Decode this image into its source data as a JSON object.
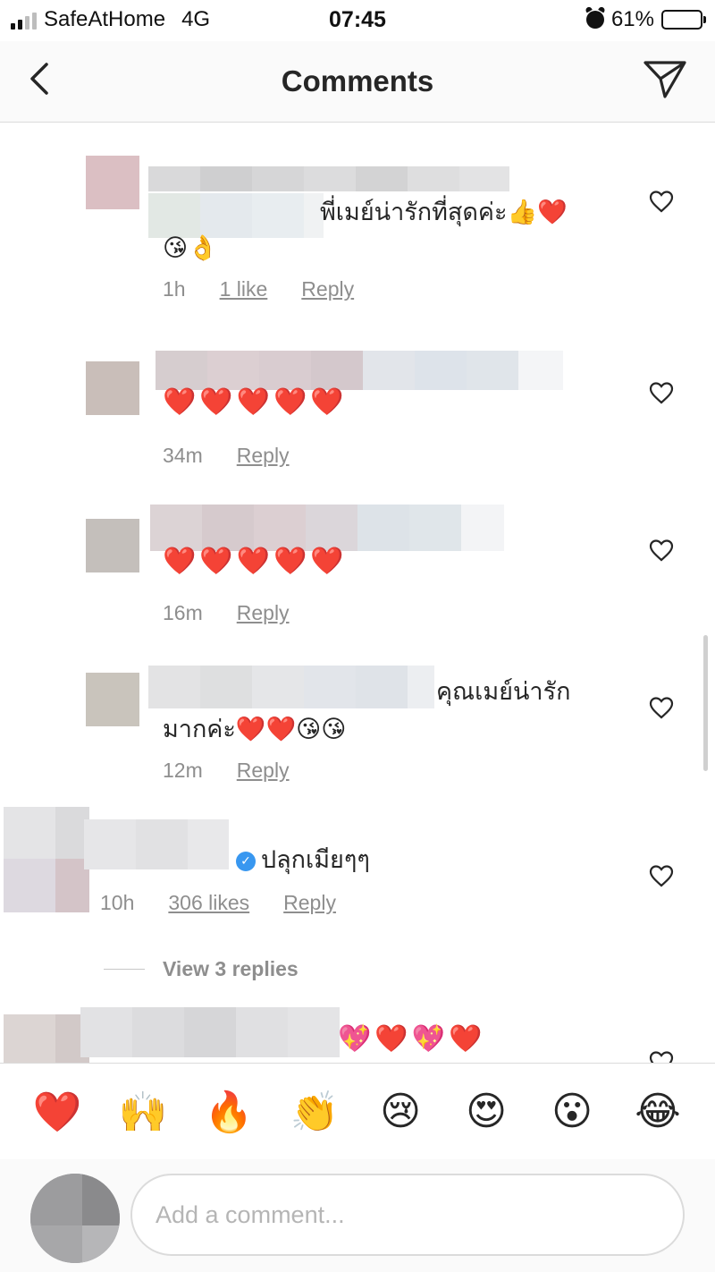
{
  "status_bar": {
    "carrier": "SafeAtHome",
    "network": "4G",
    "time": "07:45",
    "battery": "61%",
    "battery_level": 0.61
  },
  "header": {
    "title": "Comments",
    "back_icon": "chevron-left-icon",
    "send_icon": "paper-plane-icon"
  },
  "comments": [
    {
      "text_line1": "พี่เมย์น่ารักที่สุดค่ะ👍❤️",
      "text_line2": "😘👌",
      "time": "1h",
      "likes": "1 like",
      "reply": "Reply"
    },
    {
      "text_line1": "❤️❤️❤️❤️❤️",
      "time": "34m",
      "reply": "Reply"
    },
    {
      "text_line1": "❤️❤️❤️❤️❤️",
      "time": "16m",
      "reply": "Reply"
    },
    {
      "text_line1": "คุณเมย์น่ารัก",
      "text_line2": "มากค่ะ❤️❤️😘😘",
      "time": "12m",
      "reply": "Reply"
    },
    {
      "text_line1": "ปลุกเมียๆๆ",
      "time": "10h",
      "likes": "306 likes",
      "reply": "Reply",
      "verified": true
    },
    {
      "text_line1": "💖❤️💖❤️"
    }
  ],
  "view_replies": "View 3 replies",
  "emoji_bar": [
    "❤️",
    "🙌",
    "🔥",
    "👏",
    "😢",
    "😍",
    "😮",
    "😂"
  ],
  "composer": {
    "placeholder": "Add a comment..."
  },
  "colors": {
    "heart_red": "#e0152b",
    "meta_gray": "#8e8e8e",
    "verified_blue": "#3897f0",
    "border": "#dbdbdb"
  }
}
